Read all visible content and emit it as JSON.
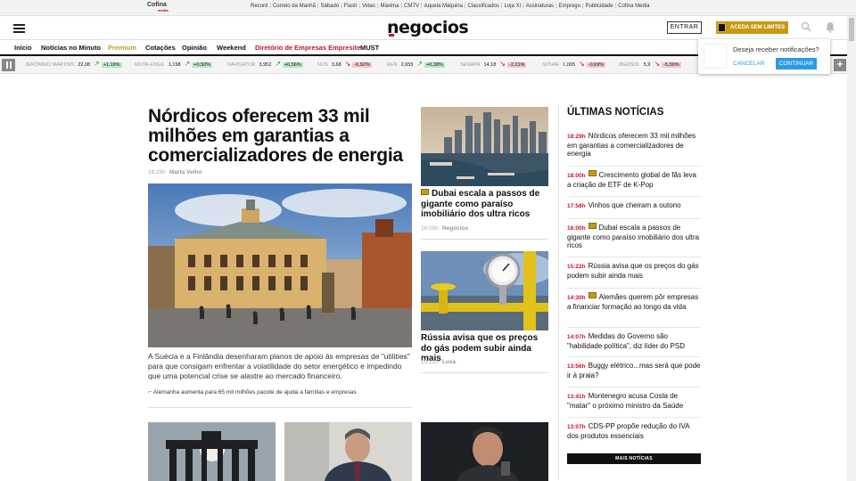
{
  "topbar": {
    "brand": "Cofina",
    "brand_sub": "media",
    "links": [
      "Record",
      "Correio da Manhã",
      "Sábado",
      "Flash",
      "Vidas",
      "Máxima",
      "CMTV",
      "Aquela Máquina",
      "Classificados",
      "Loja XI",
      "Assinaturas",
      "Emprego",
      "Publicidade",
      "Cofina Media"
    ]
  },
  "header": {
    "logo": "negocios",
    "entrar_label": "ENTRAR",
    "aceda_label": "ACEDA SEM LIMITES"
  },
  "nav": {
    "items": [
      "Início",
      "Notícias no Minuto",
      "Premium",
      "Cotações",
      "Opinião",
      "Weekend",
      "Diretório de Empresas Empresite",
      "MUST"
    ]
  },
  "ticker": [
    {
      "name": "JERÓNIMO MARTINS",
      "value": "22,08",
      "dir": "up",
      "pct": "+1,19%"
    },
    {
      "name": "MOTA-ENGIL",
      "value": "1,198",
      "dir": "up",
      "pct": "+0,50%"
    },
    {
      "name": "NAVIGATOR",
      "value": "3,952",
      "dir": "up",
      "pct": "+0,56%"
    },
    {
      "name": "NOS",
      "value": "3,68",
      "dir": "down",
      "pct": "-0,92%"
    },
    {
      "name": "REN",
      "value": "2,655",
      "dir": "up",
      "pct": "+0,38%"
    },
    {
      "name": "SEMAPA",
      "value": "14,18",
      "dir": "down",
      "pct": "-2,21%"
    },
    {
      "name": "SONAE",
      "value": "1,005",
      "dir": "down",
      "pct": "-0,69%"
    },
    {
      "name": "IBERSOL",
      "value": "5,9",
      "dir": "down",
      "pct": "-5,59%"
    }
  ],
  "notification": {
    "text": "Deseja receber notificações?",
    "cancel": "CANCELAR",
    "confirm": "CONTINUAR"
  },
  "lead": {
    "title": "Nórdicos oferecem 33 mil milhões em garantias a comercializadores de energia",
    "time": "18:29h",
    "author": "Marta Velho",
    "description": "A Suécia e a Finlândia desenharam planos de apoio às empresas de \"utilities\" para que consigam enfrentar a volatilidade do setor energético e impedindo que uma potencial crise se alastre ao mercado financeiro.",
    "related": "Alemanha aumenta para 65 mil milhões pacote de ajuda a famílias e empresas"
  },
  "mid": [
    {
      "title": "Dubai escala a passos de gigante como paraíso imobiliário dos ultra ricos",
      "time": "16:00h",
      "author": "Negócios"
    },
    {
      "title": "Rússia avisa que os preços do gás podem subir ainda mais",
      "time": "15:22h",
      "author": "Lusa"
    }
  ],
  "sidebar": {
    "title": "ÚLTIMAS NOTÍCIAS",
    "items": [
      {
        "time": "18:29h",
        "text": "Nórdicos oferecem 33 mil milhões em garantias a comercializadores de energia"
      },
      {
        "time": "18:00h",
        "text": "Crescimento global de fãs leva a criação de ETF de K-Pop"
      },
      {
        "time": "17:58h",
        "text": "Vinhos que cheiram a outono"
      },
      {
        "time": "16:00h",
        "text": "Dubai escala a passos de gigante como paraíso imobiliário dos ultra ricos"
      },
      {
        "time": "15:22h",
        "text": "Rússia avisa que os preços do gás podem subir ainda mais"
      },
      {
        "time": "14:30h",
        "text": "Alemães querem pôr empresas a financiar formação ao longo da vida"
      },
      {
        "time": "14:07h",
        "text": "Medidas do Governo são \"habilidade política\", diz líder do PSD"
      },
      {
        "time": "13:56h",
        "text": "Buggy elétrico...mas será que pode ir à praia?"
      },
      {
        "time": "13:41h",
        "text": "Montenegro acusa Costa de \"matar\" o próximo ministro da Saúde"
      },
      {
        "time": "13:07h",
        "text": "CDS-PP propõe redução do IVA dos produtos essenciais"
      }
    ],
    "more": "MAIS NOTÍCIAS"
  }
}
